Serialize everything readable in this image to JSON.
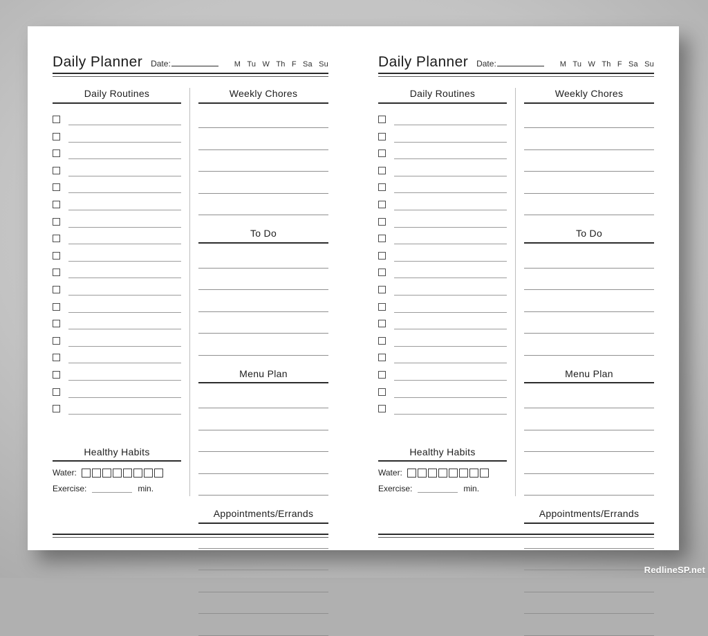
{
  "watermark": "RedlineSP.net",
  "planner": {
    "title": "Daily Planner",
    "date_label": "Date:",
    "days": [
      "M",
      "Tu",
      "W",
      "Th",
      "F",
      "Sa",
      "Su"
    ],
    "sections": {
      "daily_routines": {
        "heading": "Daily Routines",
        "checkbox_rows": 18
      },
      "weekly_chores": {
        "heading": "Weekly Chores",
        "lines": 5
      },
      "to_do": {
        "heading": "To Do",
        "lines": 5
      },
      "menu_plan": {
        "heading": "Menu Plan",
        "lines": 5
      },
      "appointments": {
        "heading": "Appointments/Errands",
        "lines": 5
      },
      "healthy_habits": {
        "heading": "Healthy Habits",
        "water_label": "Water:",
        "water_boxes": 8,
        "exercise_label": "Exercise:",
        "exercise_unit": "min."
      }
    }
  },
  "colors": {
    "ink": "#1d1d1d",
    "rule": "#2c2c2c",
    "light_rule": "#9b9b9b",
    "paper": "#ffffff",
    "backdrop": "#c3c3c3"
  }
}
